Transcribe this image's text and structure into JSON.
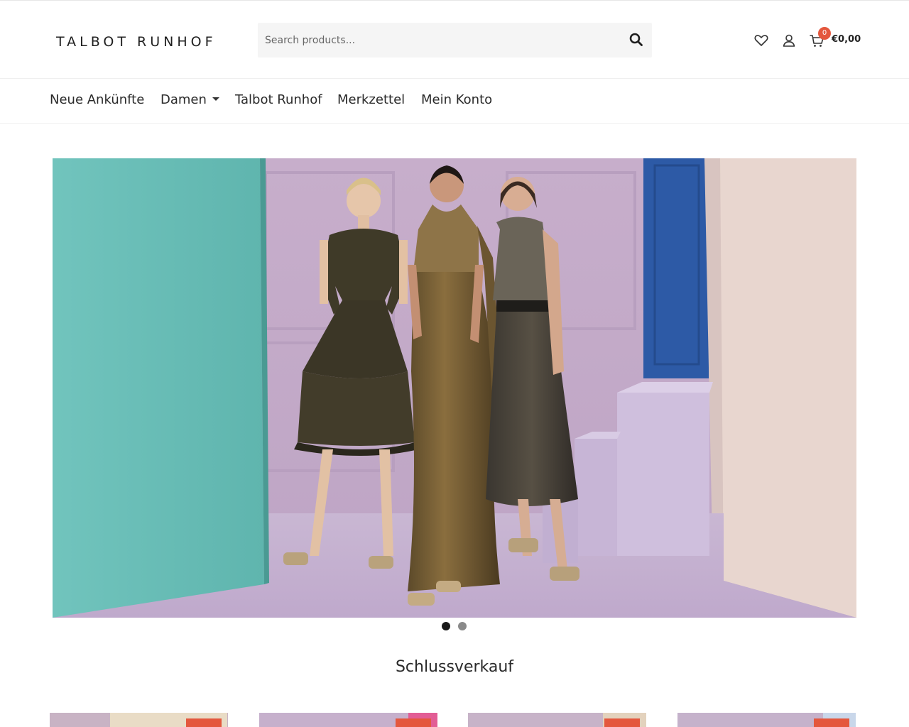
{
  "header": {
    "logo_text": "TALBOT RUNHOF",
    "search_placeholder": "Search products...",
    "cart_count": "0",
    "cart_total": "€0,00"
  },
  "nav": {
    "items": [
      {
        "label": "Neue Ankünfte"
      },
      {
        "label": "Damen"
      },
      {
        "label": "Talbot Runhof"
      },
      {
        "label": "Merkzettel"
      },
      {
        "label": "Mein Konto"
      }
    ]
  },
  "slider": {
    "slide_count": 2,
    "active_slide": 1
  },
  "main": {
    "section_title": "Schlussverkauf"
  },
  "colors": {
    "accent": "#e4573d",
    "text": "#222222",
    "search_bg": "#f5f5f5"
  },
  "icons": {
    "search": "search-icon",
    "wishlist": "heart-icon",
    "account": "user-icon",
    "cart": "cart-icon"
  }
}
